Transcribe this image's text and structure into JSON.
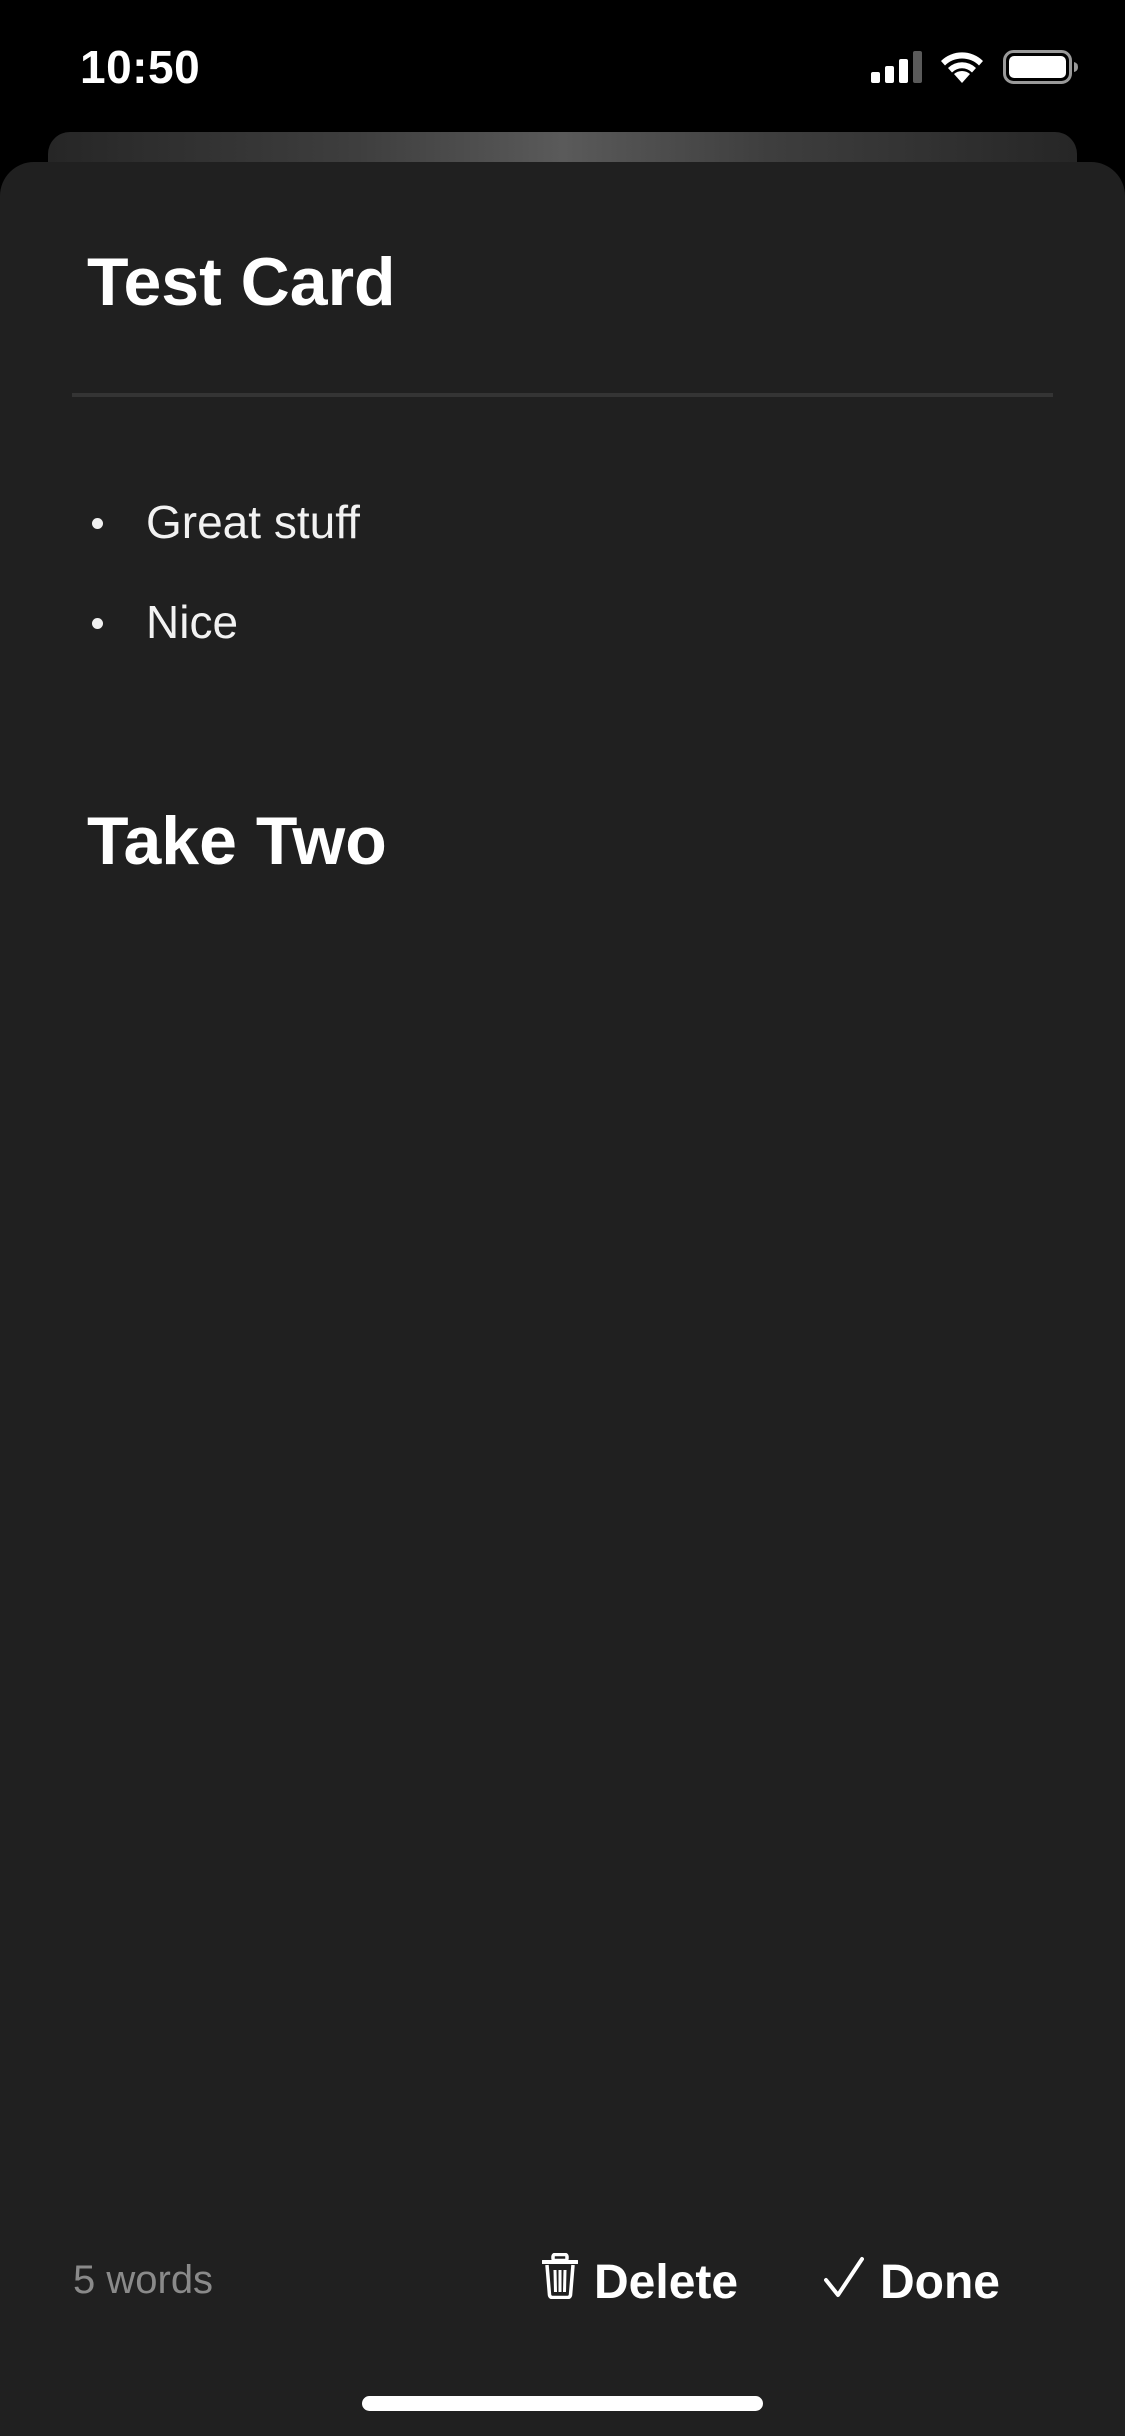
{
  "status_bar": {
    "time": "10:50",
    "icons": [
      "cellular-signal-icon",
      "wifi-icon",
      "battery-icon"
    ]
  },
  "card": {
    "title": "Test Card",
    "bullets": [
      "Great stuff",
      "Nice"
    ],
    "section_heading": "Take Two"
  },
  "toolbar": {
    "word_count": "5 words",
    "delete_label": "Delete",
    "done_label": "Done",
    "delete_icon": "trash-icon",
    "done_icon": "checkmark-icon"
  },
  "colors": {
    "background": "#000000",
    "sheet": "#202020",
    "text": "#ffffff",
    "muted_text": "#8a8a8a",
    "divider": "#343434"
  }
}
